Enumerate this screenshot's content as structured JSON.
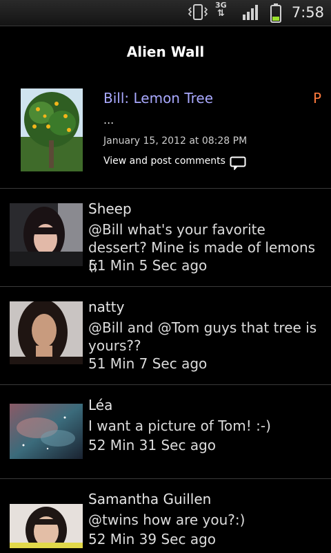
{
  "status_bar": {
    "network_label": "3G",
    "time": "7:58",
    "icons": [
      "vibrate-icon",
      "data-3g-icon",
      "signal-icon",
      "battery-icon"
    ]
  },
  "title": "Alien Wall",
  "post": {
    "title": "Bill: Lemon Tree",
    "flag": "P",
    "text": "...",
    "date": "January 15, 2012 at 08:28 PM",
    "comments_link": "View and post comments"
  },
  "comments": [
    {
      "name": "Sheep",
      "text": "@Bill what's your favorite dessert? Mine is made of lemons (;",
      "time": "51 Min 5 Sec ago"
    },
    {
      "name": "natty",
      "text": "@Bill and @Tom guys that tree is yours??",
      "time": "51 Min 7 Sec ago"
    },
    {
      "name": "Léa",
      "text": "I want a picture of Tom! :-)",
      "time": "52 Min 31 Sec ago"
    },
    {
      "name": "Samantha Guillen",
      "text": "@twins how are you?:)",
      "time": "52 Min 39 Sec ago"
    }
  ],
  "colors": {
    "post_title": "#a9a9ff",
    "flag": "#ff7a3d",
    "battery": "#9be12c",
    "background": "#000000"
  }
}
